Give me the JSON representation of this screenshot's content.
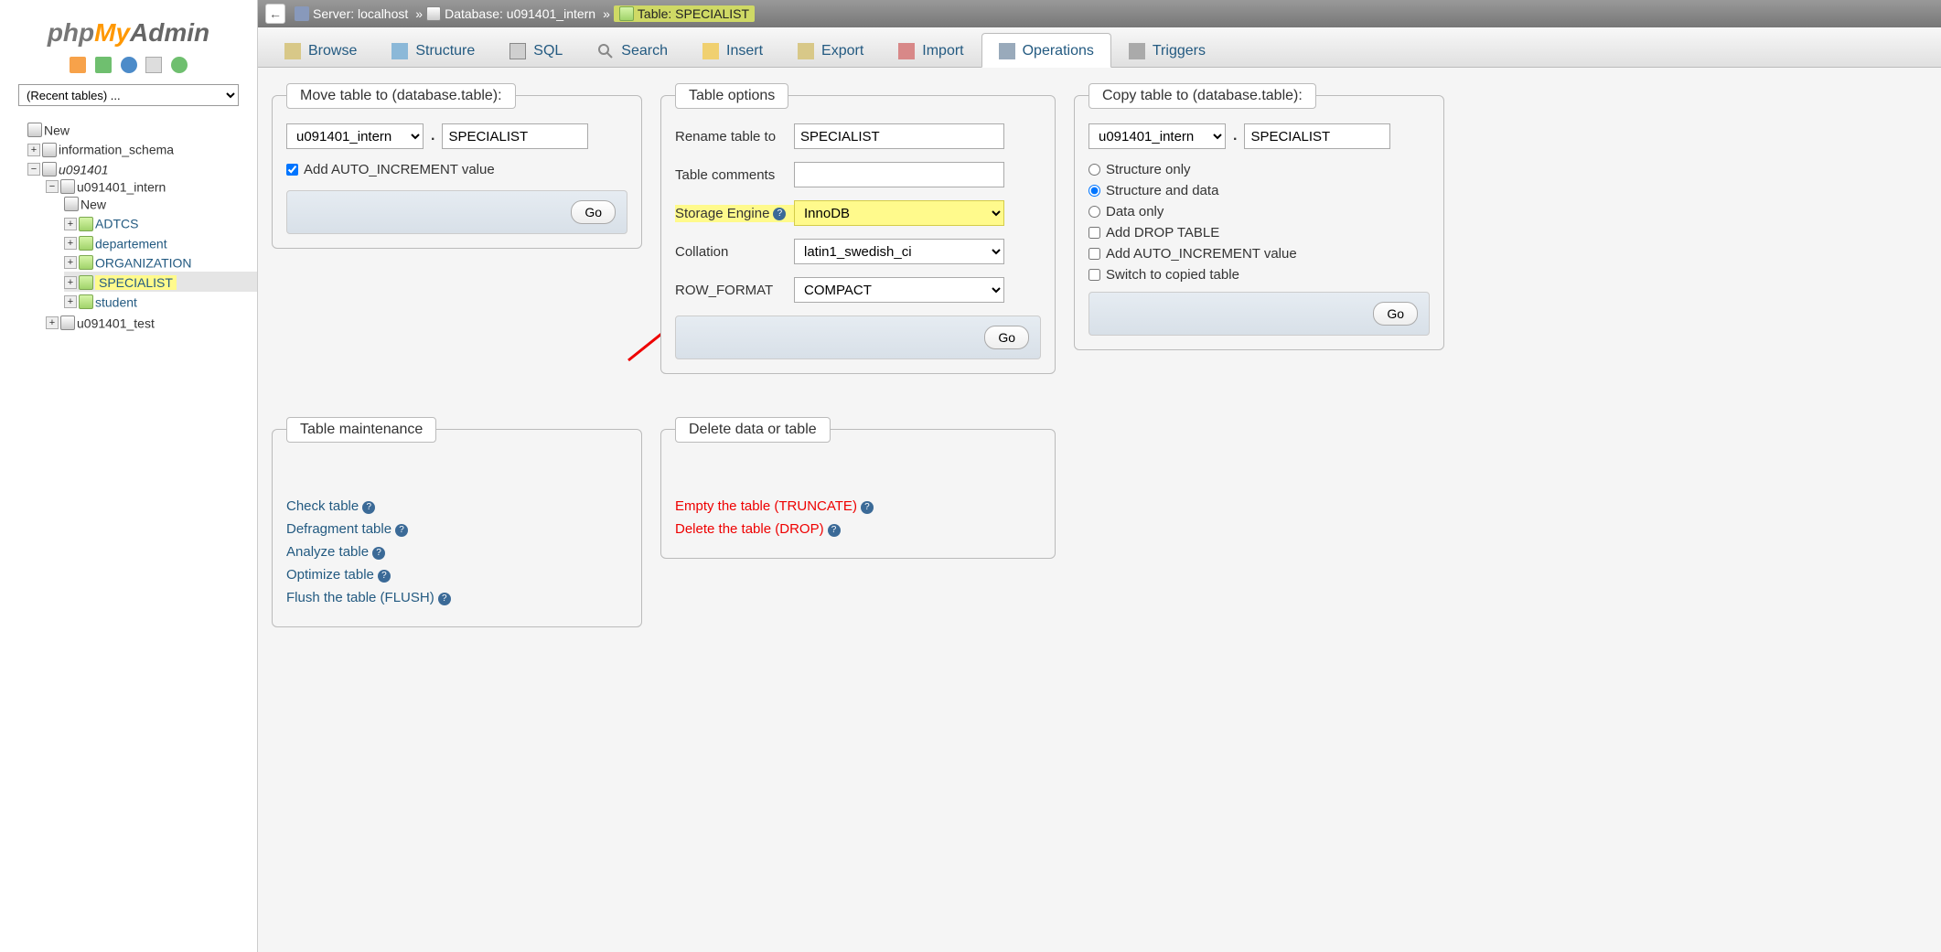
{
  "logo": {
    "php": "php",
    "my": "My",
    "admin": "Admin"
  },
  "icon_row": [
    "home",
    "exit",
    "help",
    "sql",
    "reload"
  ],
  "recent_select_value": "(Recent tables) ...",
  "tree": {
    "new": "New",
    "info_schema": "information_schema",
    "user_db": "u091401",
    "intern_db": "u091401_intern",
    "intern_children": {
      "new": "New",
      "adtcs": "ADTCS",
      "departement": "departement",
      "organization": "ORGANIZATION",
      "specialist": "SPECIALIST",
      "student": "student"
    },
    "test_db": "u091401_test"
  },
  "breadcrumb": {
    "server_label": "Server: localhost",
    "db_label": "Database: u091401_intern",
    "table_label": "Table: SPECIALIST"
  },
  "tabs": {
    "browse": "Browse",
    "structure": "Structure",
    "sql": "SQL",
    "search": "Search",
    "insert": "Insert",
    "export": "Export",
    "import": "Import",
    "operations": "Operations",
    "triggers": "Triggers"
  },
  "move": {
    "title": "Move table to (database.table):",
    "db": "u091401_intern",
    "table": "SPECIALIST",
    "auto_inc": "Add AUTO_INCREMENT value",
    "go": "Go"
  },
  "options": {
    "title": "Table options",
    "rename_label": "Rename table to",
    "rename_value": "SPECIALIST",
    "comments_label": "Table comments",
    "comments_value": "",
    "engine_label": "Storage Engine",
    "engine_value": "InnoDB",
    "collation_label": "Collation",
    "collation_value": "latin1_swedish_ci",
    "rowformat_label": "ROW_FORMAT",
    "rowformat_value": "COMPACT",
    "go": "Go"
  },
  "copy": {
    "title": "Copy table to (database.table):",
    "db": "u091401_intern",
    "table": "SPECIALIST",
    "structure_only": "Structure only",
    "structure_and_data": "Structure and data",
    "data_only": "Data only",
    "drop": "Add DROP TABLE",
    "auto_inc": "Add AUTO_INCREMENT value",
    "switch": "Switch to copied table",
    "go": "Go"
  },
  "maint": {
    "title": "Table maintenance",
    "check": "Check table",
    "defrag": "Defragment table",
    "analyze": "Analyze table",
    "optimize": "Optimize table",
    "flush": "Flush the table (FLUSH)"
  },
  "delete": {
    "title": "Delete data or table",
    "empty": "Empty the table (TRUNCATE)",
    "drop": "Delete the table (DROP)"
  }
}
